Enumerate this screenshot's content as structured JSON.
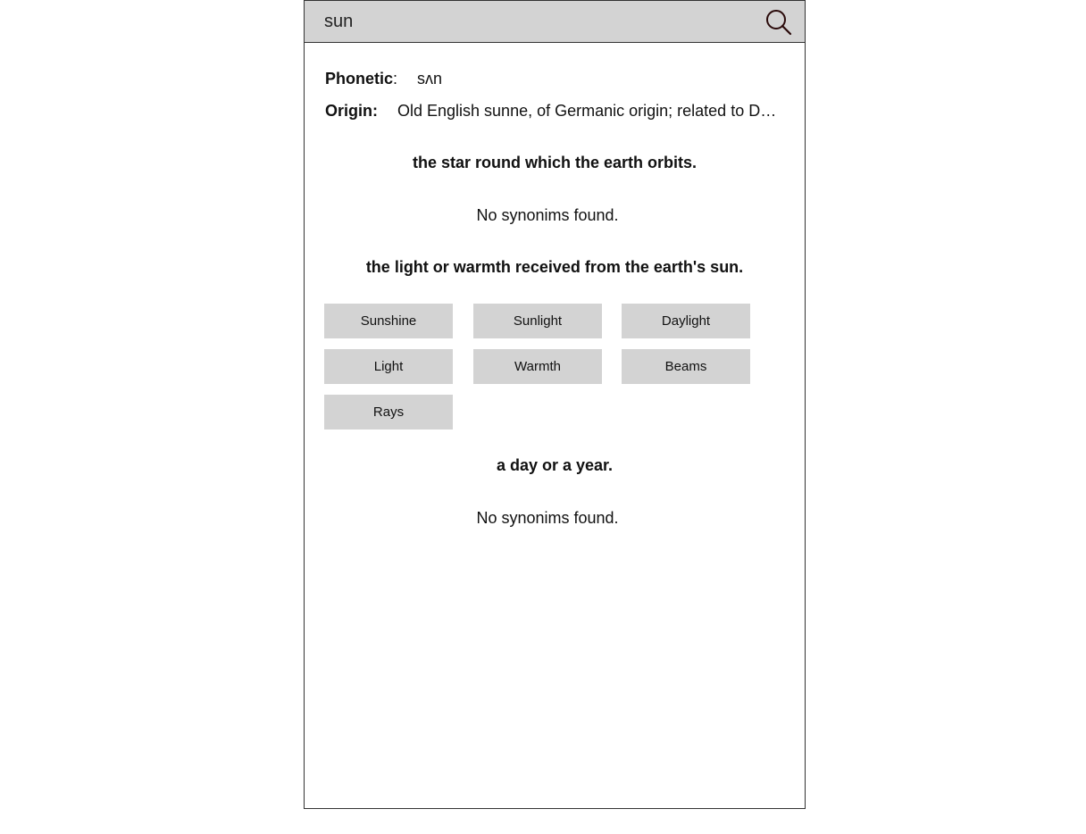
{
  "search": {
    "value": "sun",
    "icon": "search-icon"
  },
  "entry": {
    "phonetic_label": "Phonetic",
    "phonetic_colon": ":",
    "phonetic_value": "sʌn",
    "origin_label": "Origin:",
    "origin_value": "Old English sunne, of Germanic origin; related to Dutch zon and German Sonne, from an Indo-European root shared by Greek hēlios and Latin sol."
  },
  "meanings": [
    {
      "definition": "the star round which the earth orbits.",
      "no_synonyms_text": "No synonims found."
    },
    {
      "definition": "the light or warmth received from the earth's sun.",
      "synonyms": [
        "Sunshine",
        "Sunlight",
        "Daylight",
        "Light",
        "Warmth",
        "Beams",
        "Rays"
      ]
    },
    {
      "definition": "a day or a year.",
      "no_synonyms_text": "No synonims found."
    }
  ],
  "colors": {
    "searchbar_bg": "#d3d3d3",
    "synonym_bg": "#d3d3d3",
    "border": "#333333"
  }
}
